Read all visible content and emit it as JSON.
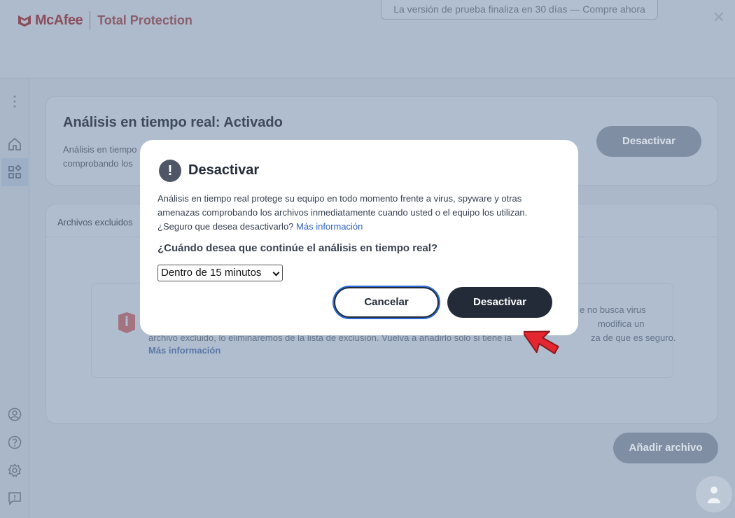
{
  "app": {
    "brand": "McAfee",
    "product": "Total Protection",
    "trial_banner": "La versión de prueba finaliza en 30 días — Compre ahora",
    "close_glyph": "✕"
  },
  "sidebar": {
    "items": [
      {
        "icon": "more-vertical-icon"
      },
      {
        "icon": "home-icon"
      },
      {
        "icon": "apps-icon",
        "active": true
      },
      {
        "icon": "account-icon"
      },
      {
        "icon": "help-icon"
      },
      {
        "icon": "settings-icon"
      },
      {
        "icon": "feedback-icon"
      }
    ]
  },
  "realtime_card": {
    "title": "Análisis en tiempo real: Activado",
    "desc_line1": "Análisis en tiempo",
    "desc_line2": "comprobando los",
    "button": "Desactivar"
  },
  "excluded_card": {
    "label": "Archivos excluidos",
    "text_line1": "e no busca virus",
    "text_line2": "modifica un",
    "text_line3a": "archivo excluido, lo eliminaremos de la lista de exclusión. Vuelva a añadirlo solo si tiene la",
    "text_line3b": "za de que es seguro.",
    "link": "Más información"
  },
  "add_file_button": "Añadir archivo",
  "modal": {
    "icon": "!",
    "title": "Desactivar",
    "body_line1": "Análisis en tiempo real protege su equipo en todo momento frente a virus, spyware y otras",
    "body_line2": "amenazas comprobando los archivos inmediatamente cuando usted o el equipo los utilizan.",
    "body_line3": "¿Seguro que desea desactivarlo?",
    "link": "Más información",
    "question": "¿Cuándo desea que continúe el análisis en tiempo real?",
    "select_value": "Dentro de 15 minutos",
    "cancel": "Cancelar",
    "confirm": "Desactivar"
  },
  "colors": {
    "overlay": "#aab8ca",
    "primary_button": "#232b38",
    "link": "#2f63c9",
    "focus_ring": "#2d6bd8",
    "pointer_arrow": "#e3262f"
  }
}
